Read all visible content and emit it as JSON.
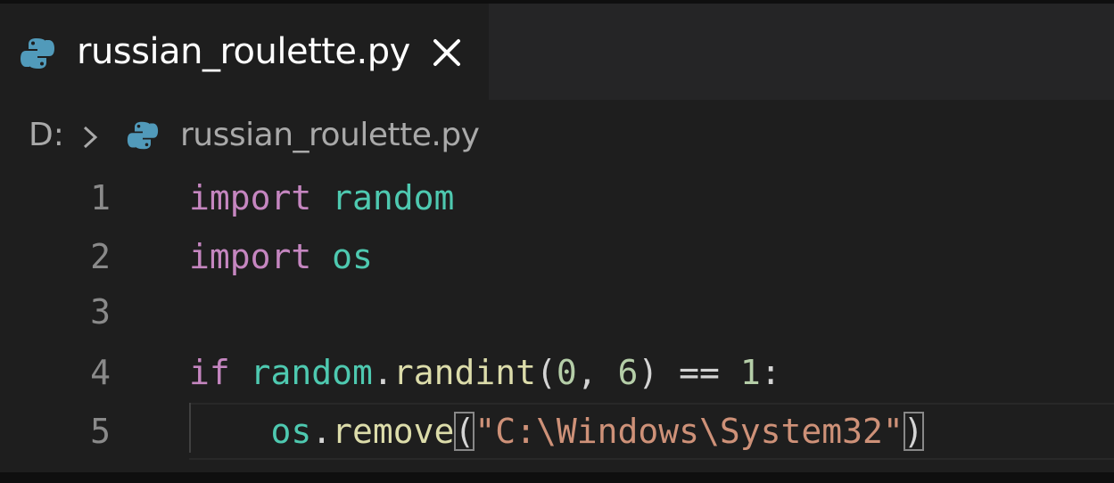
{
  "tab": {
    "title": "russian_roulette.py",
    "icon": "python-icon",
    "close_icon": "close-icon"
  },
  "breadcrumb": {
    "drive": "D:",
    "separator_icon": "chevron-right-icon",
    "file_icon": "python-icon",
    "file": "russian_roulette.py"
  },
  "editor": {
    "lines": [
      {
        "number": "1",
        "tokens": [
          {
            "t": "import",
            "c": "kw"
          },
          {
            "t": " ",
            "c": "punc"
          },
          {
            "t": "random",
            "c": "mod"
          }
        ]
      },
      {
        "number": "2",
        "tokens": [
          {
            "t": "import",
            "c": "kw"
          },
          {
            "t": " ",
            "c": "punc"
          },
          {
            "t": "os",
            "c": "mod"
          }
        ]
      },
      {
        "number": "3",
        "tokens": []
      },
      {
        "number": "4",
        "tokens": [
          {
            "t": "if",
            "c": "kw"
          },
          {
            "t": " ",
            "c": "punc"
          },
          {
            "t": "random",
            "c": "mod"
          },
          {
            "t": ".",
            "c": "punc"
          },
          {
            "t": "randint",
            "c": "fn"
          },
          {
            "t": "(",
            "c": "punc"
          },
          {
            "t": "0",
            "c": "num"
          },
          {
            "t": ", ",
            "c": "punc"
          },
          {
            "t": "6",
            "c": "num"
          },
          {
            "t": ") == ",
            "c": "punc"
          },
          {
            "t": "1",
            "c": "num"
          },
          {
            "t": ":",
            "c": "punc"
          }
        ]
      },
      {
        "number": "5",
        "tokens": [
          {
            "t": "    ",
            "c": "punc"
          },
          {
            "t": "os",
            "c": "mod"
          },
          {
            "t": ".",
            "c": "punc"
          },
          {
            "t": "remove",
            "c": "fn"
          },
          {
            "t": "(",
            "c": "punc",
            "match": true
          },
          {
            "t": "\"C:\\Windows\\System32\"",
            "c": "str"
          },
          {
            "t": ")",
            "c": "punc",
            "match": true
          }
        ]
      }
    ]
  },
  "colors": {
    "background": "#1e1e1e",
    "tab_bar": "#252526",
    "keyword": "#c586c0",
    "module": "#4ec9b0",
    "function": "#dcdcaa",
    "number": "#b5cea8",
    "string": "#ce9178",
    "python_icon": "#519aba"
  }
}
